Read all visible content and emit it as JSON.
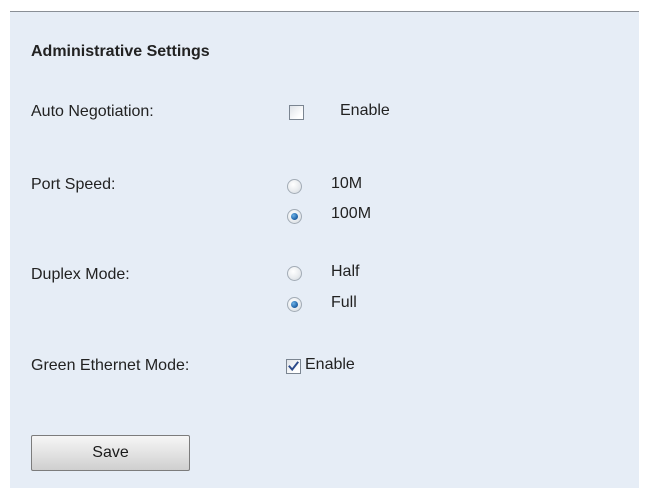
{
  "section_title": "Administrative Settings",
  "auto_negotiation": {
    "label": "Auto Negotiation:",
    "option_label": "Enable",
    "checked": false
  },
  "port_speed": {
    "label": "Port Speed:",
    "options": [
      {
        "label": "10M",
        "selected": false
      },
      {
        "label": "100M",
        "selected": true
      }
    ]
  },
  "duplex_mode": {
    "label": "Duplex Mode:",
    "options": [
      {
        "label": "Half",
        "selected": false
      },
      {
        "label": "Full",
        "selected": true
      }
    ]
  },
  "green_ethernet": {
    "label": "Green Ethernet Mode:",
    "option_label": "Enable",
    "checked": true
  },
  "save_label": "Save",
  "colors": {
    "panel_background": "#e6edf6",
    "radio_selected": "#2a6fb2",
    "checkmark": "#2c4a8a"
  }
}
